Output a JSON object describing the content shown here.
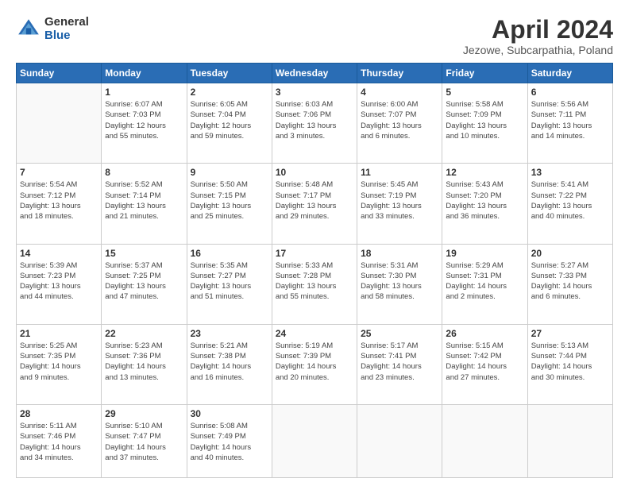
{
  "logo": {
    "general": "General",
    "blue": "Blue"
  },
  "title": "April 2024",
  "location": "Jezowe, Subcarpathia, Poland",
  "days_header": [
    "Sunday",
    "Monday",
    "Tuesday",
    "Wednesday",
    "Thursday",
    "Friday",
    "Saturday"
  ],
  "weeks": [
    [
      {
        "day": "",
        "info": ""
      },
      {
        "day": "1",
        "info": "Sunrise: 6:07 AM\nSunset: 7:03 PM\nDaylight: 12 hours\nand 55 minutes."
      },
      {
        "day": "2",
        "info": "Sunrise: 6:05 AM\nSunset: 7:04 PM\nDaylight: 12 hours\nand 59 minutes."
      },
      {
        "day": "3",
        "info": "Sunrise: 6:03 AM\nSunset: 7:06 PM\nDaylight: 13 hours\nand 3 minutes."
      },
      {
        "day": "4",
        "info": "Sunrise: 6:00 AM\nSunset: 7:07 PM\nDaylight: 13 hours\nand 6 minutes."
      },
      {
        "day": "5",
        "info": "Sunrise: 5:58 AM\nSunset: 7:09 PM\nDaylight: 13 hours\nand 10 minutes."
      },
      {
        "day": "6",
        "info": "Sunrise: 5:56 AM\nSunset: 7:11 PM\nDaylight: 13 hours\nand 14 minutes."
      }
    ],
    [
      {
        "day": "7",
        "info": "Sunrise: 5:54 AM\nSunset: 7:12 PM\nDaylight: 13 hours\nand 18 minutes."
      },
      {
        "day": "8",
        "info": "Sunrise: 5:52 AM\nSunset: 7:14 PM\nDaylight: 13 hours\nand 21 minutes."
      },
      {
        "day": "9",
        "info": "Sunrise: 5:50 AM\nSunset: 7:15 PM\nDaylight: 13 hours\nand 25 minutes."
      },
      {
        "day": "10",
        "info": "Sunrise: 5:48 AM\nSunset: 7:17 PM\nDaylight: 13 hours\nand 29 minutes."
      },
      {
        "day": "11",
        "info": "Sunrise: 5:45 AM\nSunset: 7:19 PM\nDaylight: 13 hours\nand 33 minutes."
      },
      {
        "day": "12",
        "info": "Sunrise: 5:43 AM\nSunset: 7:20 PM\nDaylight: 13 hours\nand 36 minutes."
      },
      {
        "day": "13",
        "info": "Sunrise: 5:41 AM\nSunset: 7:22 PM\nDaylight: 13 hours\nand 40 minutes."
      }
    ],
    [
      {
        "day": "14",
        "info": "Sunrise: 5:39 AM\nSunset: 7:23 PM\nDaylight: 13 hours\nand 44 minutes."
      },
      {
        "day": "15",
        "info": "Sunrise: 5:37 AM\nSunset: 7:25 PM\nDaylight: 13 hours\nand 47 minutes."
      },
      {
        "day": "16",
        "info": "Sunrise: 5:35 AM\nSunset: 7:27 PM\nDaylight: 13 hours\nand 51 minutes."
      },
      {
        "day": "17",
        "info": "Sunrise: 5:33 AM\nSunset: 7:28 PM\nDaylight: 13 hours\nand 55 minutes."
      },
      {
        "day": "18",
        "info": "Sunrise: 5:31 AM\nSunset: 7:30 PM\nDaylight: 13 hours\nand 58 minutes."
      },
      {
        "day": "19",
        "info": "Sunrise: 5:29 AM\nSunset: 7:31 PM\nDaylight: 14 hours\nand 2 minutes."
      },
      {
        "day": "20",
        "info": "Sunrise: 5:27 AM\nSunset: 7:33 PM\nDaylight: 14 hours\nand 6 minutes."
      }
    ],
    [
      {
        "day": "21",
        "info": "Sunrise: 5:25 AM\nSunset: 7:35 PM\nDaylight: 14 hours\nand 9 minutes."
      },
      {
        "day": "22",
        "info": "Sunrise: 5:23 AM\nSunset: 7:36 PM\nDaylight: 14 hours\nand 13 minutes."
      },
      {
        "day": "23",
        "info": "Sunrise: 5:21 AM\nSunset: 7:38 PM\nDaylight: 14 hours\nand 16 minutes."
      },
      {
        "day": "24",
        "info": "Sunrise: 5:19 AM\nSunset: 7:39 PM\nDaylight: 14 hours\nand 20 minutes."
      },
      {
        "day": "25",
        "info": "Sunrise: 5:17 AM\nSunset: 7:41 PM\nDaylight: 14 hours\nand 23 minutes."
      },
      {
        "day": "26",
        "info": "Sunrise: 5:15 AM\nSunset: 7:42 PM\nDaylight: 14 hours\nand 27 minutes."
      },
      {
        "day": "27",
        "info": "Sunrise: 5:13 AM\nSunset: 7:44 PM\nDaylight: 14 hours\nand 30 minutes."
      }
    ],
    [
      {
        "day": "28",
        "info": "Sunrise: 5:11 AM\nSunset: 7:46 PM\nDaylight: 14 hours\nand 34 minutes."
      },
      {
        "day": "29",
        "info": "Sunrise: 5:10 AM\nSunset: 7:47 PM\nDaylight: 14 hours\nand 37 minutes."
      },
      {
        "day": "30",
        "info": "Sunrise: 5:08 AM\nSunset: 7:49 PM\nDaylight: 14 hours\nand 40 minutes."
      },
      {
        "day": "",
        "info": ""
      },
      {
        "day": "",
        "info": ""
      },
      {
        "day": "",
        "info": ""
      },
      {
        "day": "",
        "info": ""
      }
    ]
  ]
}
